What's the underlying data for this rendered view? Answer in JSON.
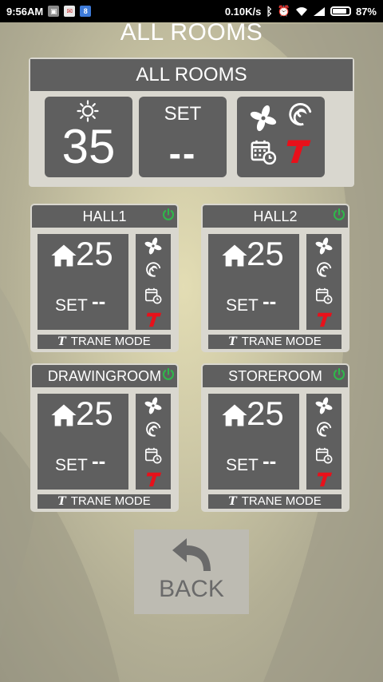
{
  "status_bar": {
    "time": "9:56AM",
    "network_speed": "0.10K/s",
    "battery_percent": "87%",
    "battery_level": 0.87,
    "icons": [
      "image-icon",
      "mail-icon",
      "app-icon",
      "bluetooth-icon",
      "alarm-icon",
      "wifi-icon",
      "signal-icon",
      "battery-icon"
    ]
  },
  "page_title": "ALL ROOMS",
  "all_rooms": {
    "header": "ALL ROOMS",
    "temperature": "35",
    "set_label": "SET",
    "set_value": "--",
    "mode_icons": [
      "sun-icon",
      "fan-icon",
      "swirl-icon",
      "schedule-icon",
      "trane-icon"
    ]
  },
  "rooms": [
    {
      "name": "HALL1",
      "temperature": "25",
      "set_label": "SET",
      "set_value": "--",
      "footer": "TRANE MODE"
    },
    {
      "name": "HALL2",
      "temperature": "25",
      "set_label": "SET",
      "set_value": "--",
      "footer": "TRANE MODE"
    },
    {
      "name": "DRAWINGROOM",
      "temperature": "25",
      "set_label": "SET",
      "set_value": "--",
      "footer": "TRANE MODE"
    },
    {
      "name": "STOREROOM",
      "temperature": "25",
      "set_label": "SET",
      "set_value": "--",
      "footer": "TRANE MODE"
    }
  ],
  "trane_mark": "T",
  "back": {
    "label": "BACK"
  },
  "colors": {
    "tile": "#5f5f5f",
    "panel": "#d9d7cf",
    "power_on": "#2fb84a",
    "trane_red": "#e8101a",
    "back_button": "#bdbbb2"
  }
}
